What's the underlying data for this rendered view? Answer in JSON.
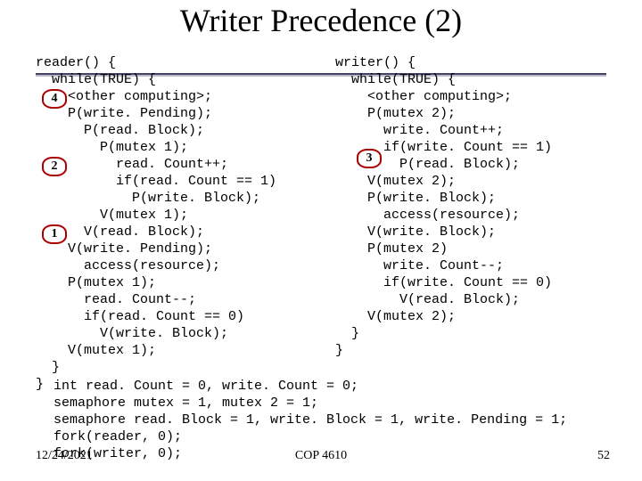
{
  "title": "Writer Precedence (2)",
  "reader_code": "reader() {\n  while(TRUE) {\n    <other computing>;\n    P(write. Pending);\n      P(read. Block);\n        P(mutex 1);\n          read. Count++;\n          if(read. Count == 1)\n            P(write. Block);\n        V(mutex 1);\n      V(read. Block);\n    V(write. Pending);\n      access(resource);\n    P(mutex 1);\n      read. Count--;\n      if(read. Count == 0)\n        V(write. Block);\n    V(mutex 1);\n  }\n}",
  "writer_code": "writer() {\n  while(TRUE) {\n    <other computing>;\n    P(mutex 2);\n      write. Count++;\n      if(write. Count == 1)\n        P(read. Block);\n    V(mutex 2);\n    P(write. Block);\n      access(resource);\n    V(write. Block);\n    P(mutex 2)\n      write. Count--;\n      if(write. Count == 0)\n        V(read. Block);\n    V(mutex 2);\n  }\n}",
  "bottom_code": "int read. Count = 0, write. Count = 0;\nsemaphore mutex = 1, mutex 2 = 1;\nsemaphore read. Block = 1, write. Block = 1, write. Pending = 1;\nfork(reader, 0);\nfork(writer, 0);",
  "badges": {
    "b1": "1",
    "b2": "2",
    "b3": "3",
    "b4": "4"
  },
  "footer": {
    "date": "12/24/2021",
    "course": "COP 4610",
    "page": "52"
  }
}
